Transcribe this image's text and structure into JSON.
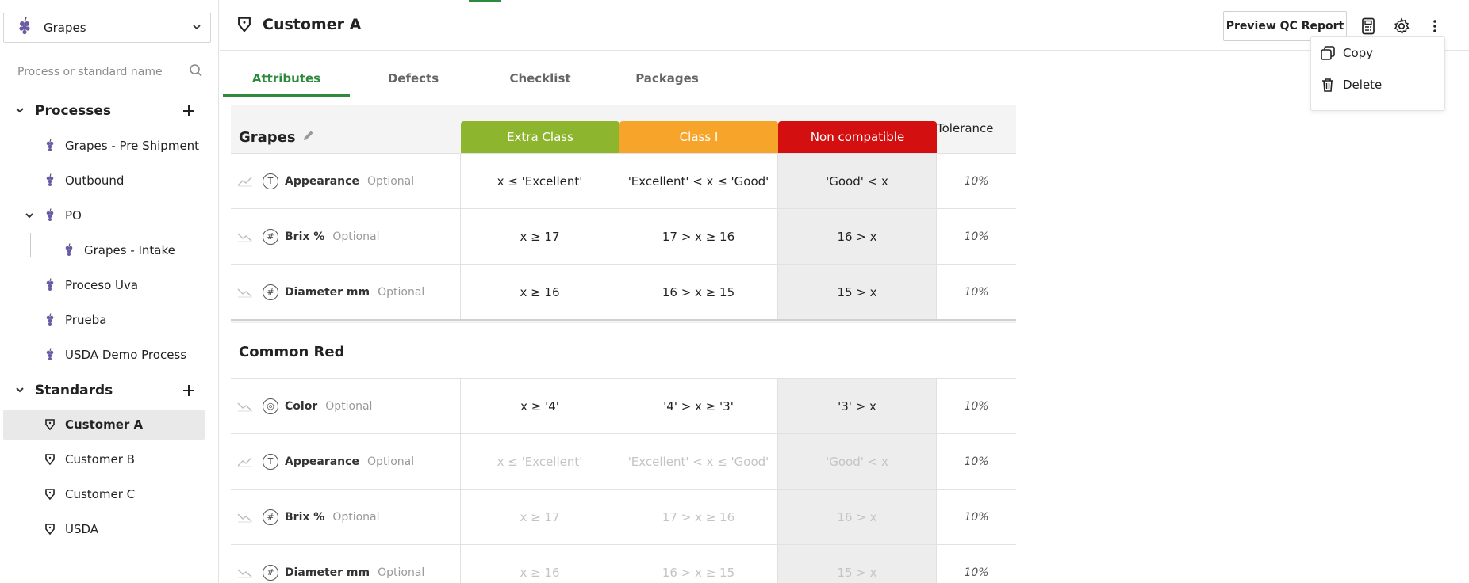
{
  "sidebar": {
    "crop": "Grapes",
    "search_placeholder": "Process or standard name",
    "processes_title": "Processes",
    "standards_title": "Standards",
    "processes": [
      {
        "label": "Grapes - Pre Shipment"
      },
      {
        "label": "Outbound"
      },
      {
        "label": "PO"
      },
      {
        "label": "Grapes - Intake"
      },
      {
        "label": "Proceso Uva"
      },
      {
        "label": "Prueba"
      },
      {
        "label": "USDA Demo Process"
      }
    ],
    "standards": [
      {
        "label": "Customer A"
      },
      {
        "label": "Customer B"
      },
      {
        "label": "Customer C"
      },
      {
        "label": "USDA"
      }
    ]
  },
  "header": {
    "title": "Customer A",
    "preview_label": "Preview QC Report"
  },
  "tabs": [
    {
      "label": "Attributes"
    },
    {
      "label": "Defects"
    },
    {
      "label": "Checklist"
    },
    {
      "label": "Packages"
    }
  ],
  "menu": {
    "copy": "Copy",
    "delete": "Delete"
  },
  "table": {
    "grades": [
      {
        "label": "Extra Class",
        "color": "#8db52e"
      },
      {
        "label": "Class I",
        "color": "#f7a52a"
      },
      {
        "label": "Non compatible",
        "color": "#d40f0f"
      }
    ],
    "tolerance_label": "Tolerance",
    "groups": [
      {
        "name": "Grapes",
        "rows": [
          {
            "icon": "T",
            "name": "Appearance",
            "opt": "Optional",
            "c1": "x ≤ 'Excellent'",
            "c2": "'Excellent' < x ≤ 'Good'",
            "c3": "'Good' < x",
            "tol": "10%"
          },
          {
            "icon": "#",
            "name": "Brix %",
            "opt": "Optional",
            "c1": "x ≥ 17",
            "c2": "17 > x ≥ 16",
            "c3": "16 > x",
            "tol": "10%"
          },
          {
            "icon": "#",
            "name": "Diameter mm",
            "opt": "Optional",
            "c1": "x ≥ 16",
            "c2": "16 > x ≥ 15",
            "c3": "15 > x",
            "tol": "10%"
          }
        ]
      },
      {
        "name": "Common Red",
        "rows": [
          {
            "icon": "◎",
            "name": "Color",
            "opt": "Optional",
            "c1": "x ≥ '4'",
            "c2": "'4' > x ≥ '3'",
            "c3": "'3' > x",
            "tol": "10%"
          },
          {
            "icon": "T",
            "name": "Appearance",
            "opt": "Optional",
            "c1": "x ≤ 'Excellent'",
            "c2": "'Excellent' < x ≤ 'Good'",
            "c3": "'Good' < x",
            "tol": "10%"
          },
          {
            "icon": "#",
            "name": "Brix %",
            "opt": "Optional",
            "c1": "x ≥ 17",
            "c2": "17 > x ≥ 16",
            "c3": "16 > x",
            "tol": "10%"
          },
          {
            "icon": "#",
            "name": "Diameter mm",
            "opt": "Optional",
            "c1": "x ≥ 16",
            "c2": "16 > x ≥ 15",
            "c3": "15 > x",
            "tol": "10%"
          }
        ]
      }
    ]
  }
}
